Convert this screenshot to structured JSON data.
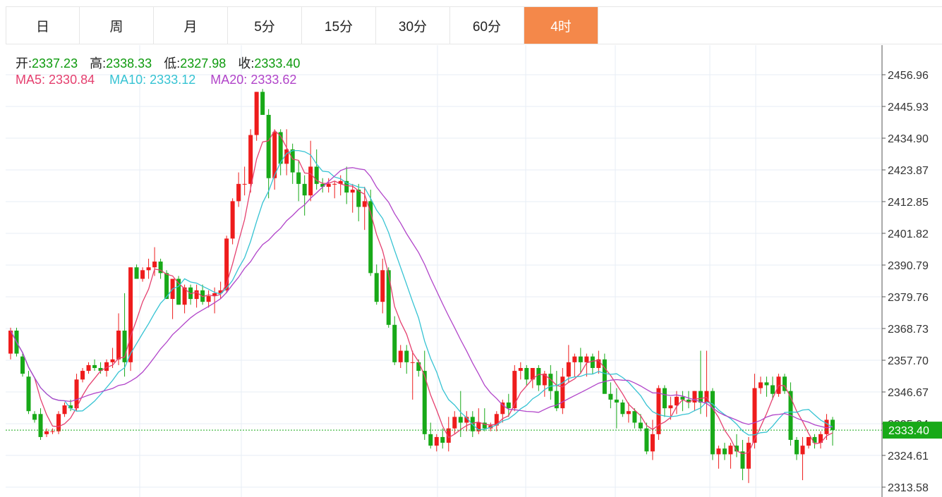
{
  "tabs": [
    {
      "label": "日"
    },
    {
      "label": "周"
    },
    {
      "label": "月"
    },
    {
      "label": "5分"
    },
    {
      "label": "15分"
    },
    {
      "label": "30分"
    },
    {
      "label": "60分"
    },
    {
      "label": "4时"
    }
  ],
  "active_tab": 7,
  "colors": {
    "up": "#ee1c1c",
    "down": "#18a918",
    "active_tab": "#f4884a",
    "ma5": "#e5406f",
    "ma10": "#36c3d3",
    "ma20": "#b144c9",
    "grid": "#e7eef5",
    "value_text": "#0d9a0d"
  },
  "ohlc": {
    "open_label": "开:",
    "open": "2337.23",
    "high_label": "高:",
    "high": "2338.33",
    "low_label": "低:",
    "low": "2327.98",
    "close_label": "收:",
    "close": "2333.40"
  },
  "ma_legend": {
    "ma5_label": "MA5:",
    "ma5": "2330.84",
    "ma10_label": "MA10:",
    "ma10": "2333.12",
    "ma20_label": "MA20:",
    "ma20": "2333.62"
  },
  "chart_data": {
    "type": "candlestick",
    "y_ticks": [
      "2456.96",
      "2445.93",
      "2434.90",
      "2423.87",
      "2412.85",
      "2401.82",
      "2390.79",
      "2379.76",
      "2368.73",
      "2357.70",
      "2346.67",
      "2335.64",
      "2324.61",
      "2313.58"
    ],
    "ylim": [
      2313.58,
      2456.96
    ],
    "last_price": "2333.40",
    "grid": true,
    "candles": [
      [
        2360,
        2369,
        2358,
        2368
      ],
      [
        2368,
        2369,
        2359,
        2360
      ],
      [
        2359,
        2360,
        2352,
        2353
      ],
      [
        2352,
        2354,
        2339,
        2340
      ],
      [
        2339,
        2340,
        2336,
        2337
      ],
      [
        2339,
        2341,
        2330,
        2331
      ],
      [
        2332,
        2334,
        2331,
        2333
      ],
      [
        2333,
        2334,
        2332,
        2333
      ],
      [
        2333,
        2340,
        2332,
        2339
      ],
      [
        2339,
        2343,
        2338,
        2342
      ],
      [
        2342,
        2344,
        2340,
        2341
      ],
      [
        2341,
        2353,
        2340,
        2351
      ],
      [
        2351,
        2355,
        2350,
        2354
      ],
      [
        2354,
        2357,
        2353,
        2356
      ],
      [
        2356,
        2358,
        2354,
        2355
      ],
      [
        2355,
        2357,
        2353,
        2354
      ],
      [
        2354,
        2358,
        2352,
        2357
      ],
      [
        2357,
        2362,
        2355,
        2358
      ],
      [
        2358,
        2374,
        2356,
        2368
      ],
      [
        2368,
        2381,
        2352,
        2357
      ],
      [
        2357,
        2390,
        2354,
        2390
      ],
      [
        2390,
        2391,
        2386,
        2386
      ],
      [
        2386,
        2390,
        2385,
        2389
      ],
      [
        2389,
        2393,
        2386,
        2390
      ],
      [
        2390,
        2397,
        2387,
        2392
      ],
      [
        2392,
        2393,
        2386,
        2388
      ],
      [
        2388,
        2389,
        2379,
        2379
      ],
      [
        2379,
        2386,
        2372,
        2386
      ],
      [
        2386,
        2387,
        2377,
        2377
      ],
      [
        2377,
        2384,
        2374,
        2383
      ],
      [
        2383,
        2384,
        2377,
        2379
      ],
      [
        2379,
        2384,
        2376,
        2382
      ],
      [
        2382,
        2384,
        2377,
        2378
      ],
      [
        2378,
        2382,
        2376,
        2380
      ],
      [
        2380,
        2383,
        2374,
        2381
      ],
      [
        2381,
        2385,
        2379,
        2382
      ],
      [
        2382,
        2401,
        2381,
        2400
      ],
      [
        2400,
        2414,
        2398,
        2413
      ],
      [
        2413,
        2423,
        2411,
        2419
      ],
      [
        2419,
        2425,
        2415,
        2419
      ],
      [
        2419,
        2438,
        2416,
        2436
      ],
      [
        2436,
        2451,
        2434,
        2451
      ],
      [
        2451,
        2452,
        2443,
        2443
      ],
      [
        2443,
        2445,
        2414,
        2421
      ],
      [
        2421,
        2438,
        2417,
        2437
      ],
      [
        2437,
        2438,
        2422,
        2426
      ],
      [
        2426,
        2438,
        2422,
        2431
      ],
      [
        2431,
        2433,
        2419,
        2423
      ],
      [
        2423,
        2427,
        2413,
        2419
      ],
      [
        2419,
        2422,
        2408,
        2415
      ],
      [
        2415,
        2434,
        2413,
        2425
      ],
      [
        2425,
        2431,
        2417,
        2419
      ],
      [
        2419,
        2421,
        2416,
        2418
      ],
      [
        2418,
        2421,
        2416,
        2419
      ],
      [
        2419,
        2420,
        2414,
        2419
      ],
      [
        2419,
        2422,
        2415,
        2420
      ],
      [
        2420,
        2425,
        2412,
        2416
      ],
      [
        2416,
        2419,
        2409,
        2417
      ],
      [
        2417,
        2419,
        2406,
        2411
      ],
      [
        2411,
        2418,
        2403,
        2413
      ],
      [
        2413,
        2417,
        2387,
        2388
      ],
      [
        2388,
        2391,
        2377,
        2378
      ],
      [
        2378,
        2393,
        2374,
        2389
      ],
      [
        2389,
        2390,
        2369,
        2370
      ],
      [
        2370,
        2373,
        2356,
        2357
      ],
      [
        2357,
        2363,
        2355,
        2361
      ],
      [
        2361,
        2363,
        2353,
        2357
      ],
      [
        2357,
        2361,
        2344,
        2357
      ],
      [
        2357,
        2358,
        2352,
        2354
      ],
      [
        2354,
        2361,
        2330,
        2332
      ],
      [
        2332,
        2336,
        2327,
        2328
      ],
      [
        2328,
        2332,
        2326,
        2331
      ],
      [
        2331,
        2334,
        2327,
        2329
      ],
      [
        2329,
        2338,
        2326,
        2334
      ],
      [
        2334,
        2340,
        2332,
        2338
      ],
      [
        2338,
        2347,
        2331,
        2336
      ],
      [
        2336,
        2340,
        2333,
        2338
      ],
      [
        2338,
        2340,
        2331,
        2333
      ],
      [
        2333,
        2341,
        2332,
        2336
      ],
      [
        2336,
        2341,
        2333,
        2334
      ],
      [
        2334,
        2336,
        2333,
        2335
      ],
      [
        2335,
        2340,
        2333,
        2339
      ],
      [
        2339,
        2344,
        2336,
        2343
      ],
      [
        2343,
        2346,
        2338,
        2341
      ],
      [
        2341,
        2356,
        2340,
        2354
      ],
      [
        2354,
        2357,
        2351,
        2355
      ],
      [
        2355,
        2356,
        2349,
        2351
      ],
      [
        2351,
        2355,
        2348,
        2355
      ],
      [
        2355,
        2356,
        2347,
        2349
      ],
      [
        2349,
        2354,
        2345,
        2353
      ],
      [
        2353,
        2356,
        2344,
        2347
      ],
      [
        2347,
        2354,
        2340,
        2341
      ],
      [
        2341,
        2355,
        2339,
        2352
      ],
      [
        2352,
        2363,
        2350,
        2357
      ],
      [
        2357,
        2360,
        2352,
        2359
      ],
      [
        2359,
        2362,
        2353,
        2357
      ],
      [
        2357,
        2360,
        2352,
        2359
      ],
      [
        2359,
        2360,
        2353,
        2355
      ],
      [
        2355,
        2361,
        2353,
        2358
      ],
      [
        2358,
        2360,
        2348,
        2346
      ],
      [
        2346,
        2350,
        2341,
        2344
      ],
      [
        2344,
        2348,
        2334,
        2343
      ],
      [
        2343,
        2344,
        2338,
        2339
      ],
      [
        2339,
        2343,
        2336,
        2340
      ],
      [
        2340,
        2341,
        2334,
        2336
      ],
      [
        2336,
        2339,
        2333,
        2334
      ],
      [
        2334,
        2336,
        2325,
        2326
      ],
      [
        2326,
        2337,
        2323,
        2332
      ],
      [
        2332,
        2349,
        2330,
        2348
      ],
      [
        2348,
        2349,
        2338,
        2341
      ],
      [
        2341,
        2345,
        2337,
        2342
      ],
      [
        2342,
        2347,
        2339,
        2345
      ],
      [
        2345,
        2347,
        2340,
        2344
      ],
      [
        2344,
        2347,
        2341,
        2343
      ],
      [
        2343,
        2347,
        2340,
        2347
      ],
      [
        2347,
        2361,
        2339,
        2343
      ],
      [
        2343,
        2361,
        2338,
        2347
      ],
      [
        2347,
        2348,
        2323,
        2325
      ],
      [
        2325,
        2328,
        2320,
        2327
      ],
      [
        2327,
        2329,
        2323,
        2325
      ],
      [
        2325,
        2329,
        2320,
        2328
      ],
      [
        2328,
        2332,
        2324,
        2326
      ],
      [
        2326,
        2330,
        2316,
        2320
      ],
      [
        2320,
        2331,
        2315,
        2329
      ],
      [
        2329,
        2353,
        2327,
        2348
      ],
      [
        2348,
        2352,
        2346,
        2350
      ],
      [
        2350,
        2352,
        2345,
        2349
      ],
      [
        2349,
        2352,
        2344,
        2346
      ],
      [
        2346,
        2353,
        2345,
        2352
      ],
      [
        2352,
        2353,
        2346,
        2347
      ],
      [
        2347,
        2350,
        2328,
        2330
      ],
      [
        2330,
        2331,
        2323,
        2325
      ],
      [
        2325,
        2331,
        2316,
        2328
      ],
      [
        2328,
        2331,
        2327,
        2331
      ],
      [
        2331,
        2332,
        2327,
        2329
      ],
      [
        2329,
        2333,
        2327,
        2332
      ],
      [
        2332,
        2339,
        2330,
        2337
      ],
      [
        2337,
        2338,
        2328,
        2333.4
      ]
    ]
  }
}
